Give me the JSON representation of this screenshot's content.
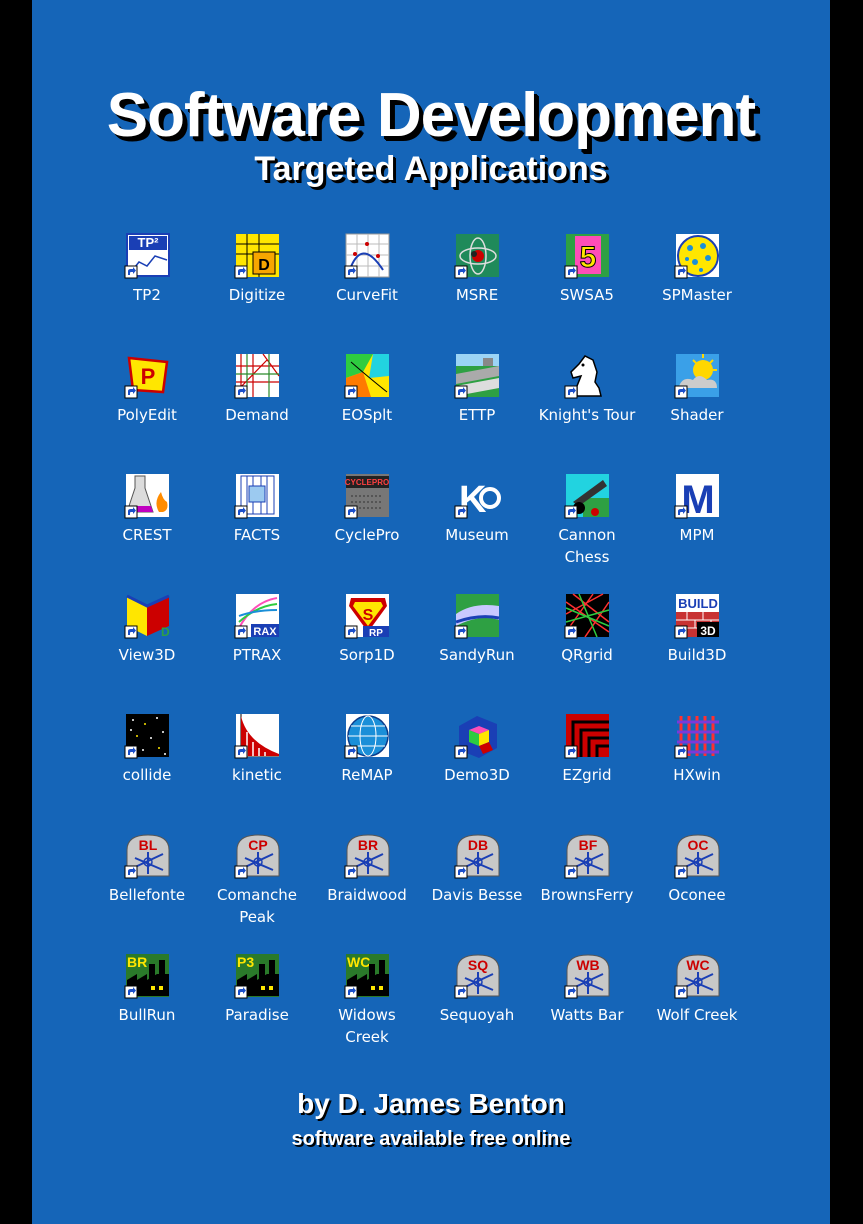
{
  "title": "Software Development",
  "subtitle": "Targeted Applications",
  "byline": "by D. James Benton",
  "tagline": "software available free online",
  "colors": {
    "background": "#1565b8",
    "frame": "#000000",
    "text": "#ffffff"
  },
  "icons": [
    {
      "label": "TP2",
      "icon": "tp2-icon"
    },
    {
      "label": "Digitize",
      "icon": "digitize-icon"
    },
    {
      "label": "CurveFit",
      "icon": "curvefit-icon"
    },
    {
      "label": "MSRE",
      "icon": "msre-icon"
    },
    {
      "label": "SWSA5",
      "icon": "swsa5-icon"
    },
    {
      "label": "SPMaster",
      "icon": "spmaster-icon"
    },
    {
      "label": "PolyEdit",
      "icon": "polyedit-icon"
    },
    {
      "label": "Demand",
      "icon": "demand-icon"
    },
    {
      "label": "EOSplt",
      "icon": "eosplt-icon"
    },
    {
      "label": "ETTP",
      "icon": "ettp-icon"
    },
    {
      "label": "Knight's Tour",
      "icon": "knights-tour-icon"
    },
    {
      "label": "Shader",
      "icon": "shader-icon"
    },
    {
      "label": "CREST",
      "icon": "crest-icon"
    },
    {
      "label": "FACTS",
      "icon": "facts-icon"
    },
    {
      "label": "CyclePro",
      "icon": "cyclepro-icon"
    },
    {
      "label": "Museum",
      "icon": "museum-icon"
    },
    {
      "label": "Cannon\nChess",
      "icon": "cannon-chess-icon"
    },
    {
      "label": "MPM",
      "icon": "mpm-icon"
    },
    {
      "label": "View3D",
      "icon": "view3d-icon"
    },
    {
      "label": "PTRAX",
      "icon": "ptrax-icon"
    },
    {
      "label": "Sorp1D",
      "icon": "sorp1d-icon"
    },
    {
      "label": "SandyRun",
      "icon": "sandyrun-icon"
    },
    {
      "label": "QRgrid",
      "icon": "qrgrid-icon"
    },
    {
      "label": "Build3D",
      "icon": "build3d-icon"
    },
    {
      "label": "collide",
      "icon": "collide-icon"
    },
    {
      "label": "kinetic",
      "icon": "kinetic-icon"
    },
    {
      "label": "ReMAP",
      "icon": "remap-icon"
    },
    {
      "label": "Demo3D",
      "icon": "demo3d-icon"
    },
    {
      "label": "EZgrid",
      "icon": "ezgrid-icon"
    },
    {
      "label": "HXwin",
      "icon": "hxwin-icon"
    },
    {
      "label": "Bellefonte",
      "icon": "plant-bl-icon",
      "code": "BL"
    },
    {
      "label": "Comanche\nPeak",
      "icon": "plant-cp-icon",
      "code": "CP"
    },
    {
      "label": "Braidwood",
      "icon": "plant-br-icon",
      "code": "BR"
    },
    {
      "label": "Davis Besse",
      "icon": "plant-db-icon",
      "code": "DB"
    },
    {
      "label": "BrownsFerry",
      "icon": "plant-bf-icon",
      "code": "BF"
    },
    {
      "label": "Oconee",
      "icon": "plant-oc-icon",
      "code": "OC"
    },
    {
      "label": "BullRun",
      "icon": "factory-br-icon",
      "code": "BR"
    },
    {
      "label": "Paradise",
      "icon": "factory-p3-icon",
      "code": "P3"
    },
    {
      "label": "Widows\nCreek",
      "icon": "factory-wc-icon",
      "code": "WC"
    },
    {
      "label": "Sequoyah",
      "icon": "plant-sq-icon",
      "code": "SQ"
    },
    {
      "label": "Watts Bar",
      "icon": "plant-wb-icon",
      "code": "WB"
    },
    {
      "label": "Wolf Creek",
      "icon": "plant-wc-icon",
      "code": "WC"
    }
  ]
}
